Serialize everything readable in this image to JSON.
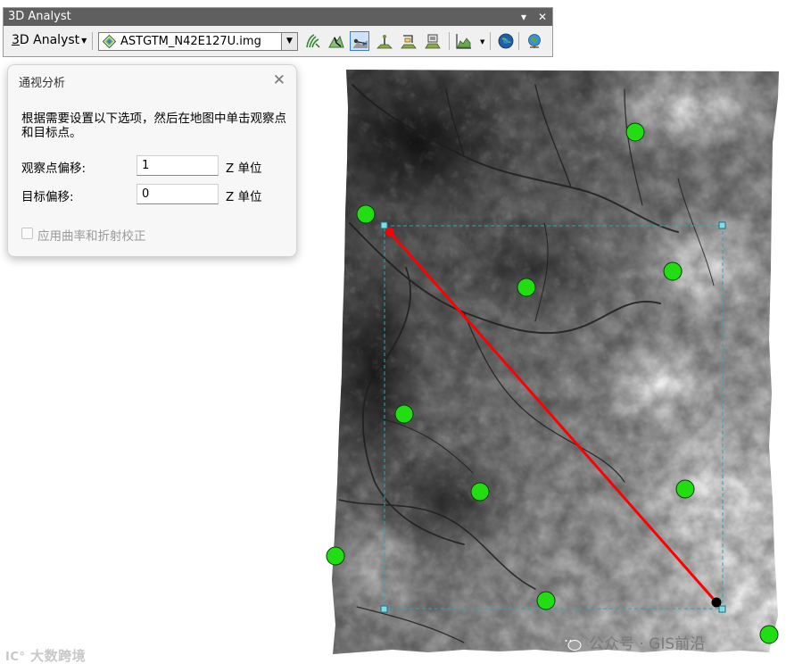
{
  "toolbar": {
    "title": "3D Analyst",
    "menu_label": "3D Analyst",
    "menu_mnemonic": "3",
    "layer_name": "ASTGTM_N42E127U.img",
    "buttons": [
      {
        "name": "contour-tool-icon"
      },
      {
        "name": "steepest-path-icon"
      },
      {
        "name": "line-of-sight-icon",
        "active": true
      },
      {
        "name": "interpolate-point-icon"
      },
      {
        "name": "interpolate-line-icon"
      },
      {
        "name": "interpolate-polygon-icon"
      },
      {
        "name": "profile-graph-icon"
      },
      {
        "name": "arcscene-icon"
      },
      {
        "name": "arcglobe-icon"
      }
    ]
  },
  "panel": {
    "title": "通视分析",
    "instructions": "根据需要设置以下选项，然后在地图中单击观察点和目标点。",
    "observer_offset_label": "观察点偏移:",
    "observer_offset_value": "1",
    "target_offset_label": "目标偏移:",
    "target_offset_value": "0",
    "unit_label": "Z 单位",
    "curvature_label": "应用曲率和折射校正",
    "curvature_checked": false
  },
  "map": {
    "point_color": "#22dd11",
    "sight_line_color": "#ff0000",
    "selection_color": "#2aa6b8"
  },
  "watermarks": {
    "left": "大数跨境",
    "right": "公众号 · GIS前沿"
  }
}
